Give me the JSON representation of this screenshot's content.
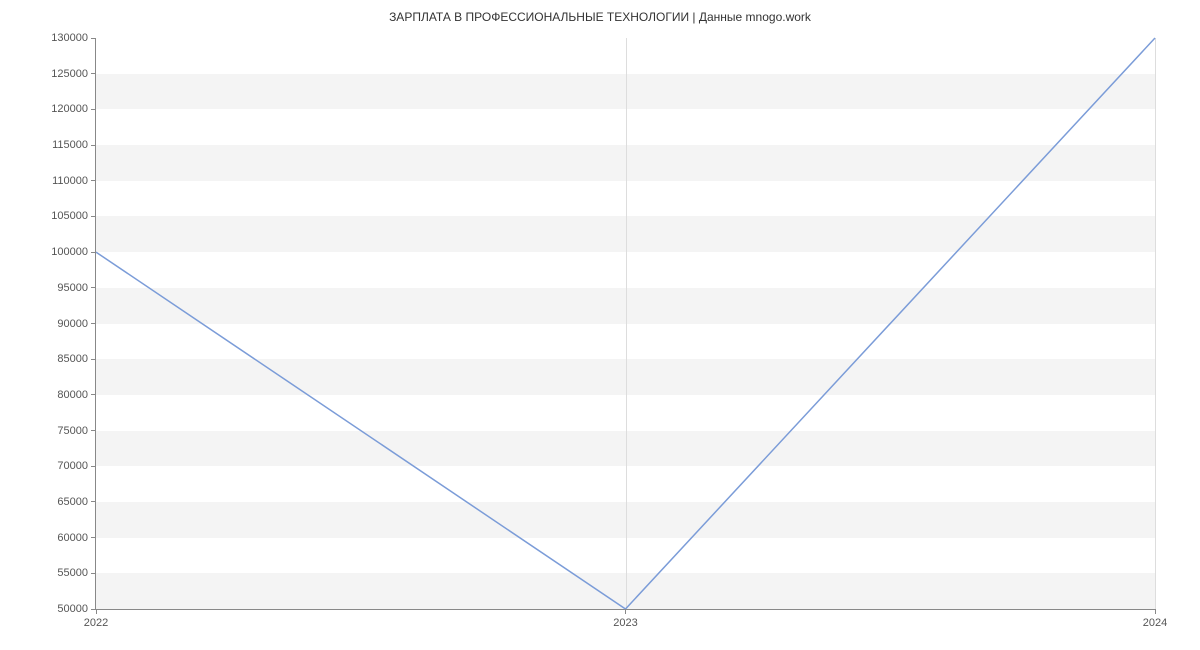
{
  "chart_data": {
    "type": "line",
    "title": "ЗАРПЛАТА В  ПРОФЕССИОНАЛЬНЫЕ ТЕХНОЛОГИИ | Данные mnogo.work",
    "xlabel": "",
    "ylabel": "",
    "x": [
      2022,
      2023,
      2024
    ],
    "values": [
      100000,
      50000,
      130000
    ],
    "x_ticks": [
      2022,
      2023,
      2024
    ],
    "y_ticks": [
      50000,
      55000,
      60000,
      65000,
      70000,
      75000,
      80000,
      85000,
      90000,
      95000,
      100000,
      105000,
      110000,
      115000,
      120000,
      125000,
      130000
    ],
    "xlim": [
      2022,
      2024
    ],
    "ylim": [
      50000,
      130000
    ],
    "line_color": "#7b9cd8",
    "grid_alternate": true
  }
}
